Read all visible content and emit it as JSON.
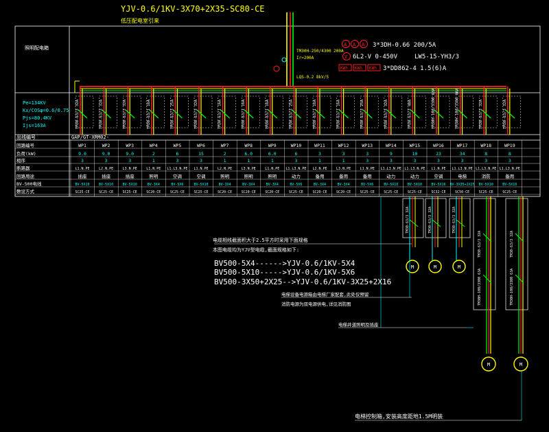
{
  "title": {
    "cable": "YJV-0.6/1KV-3X70+2X35-SC80-CE",
    "source": "低压配电室引来"
  },
  "panel": {
    "label": "照明配电箱",
    "params": [
      "Pe=134KV",
      "Kx/COSφ=0.6/0.75",
      "Pjs=80.4KV",
      "Ijs=163A"
    ]
  },
  "incoming": {
    "breaker": "TM30H-250/4300 200A",
    "setting": "Ir=200A",
    "surge": "LQS-0.2 8kV/5",
    "meters": [
      "A",
      "A",
      "A"
    ],
    "ct": "3*3DH-0.66 200/5A",
    "volt_meter": "V",
    "volt_label": "6L2-V 0-450V",
    "switch": "LW5-15-YH3/3",
    "kwh": [
      "KWh",
      "KWh",
      "KWh"
    ],
    "kwh_label": "3*DD862-4 1.5(6)A"
  },
  "table": {
    "header_label": "GAP/GT-XRM02-",
    "row_labels": [
      "回路编号",
      "负荷(kW)",
      "相序",
      "断路器",
      "回路用途",
      "BV-500电线",
      "敷设方式"
    ],
    "left_first": "出线编号",
    "circuits": [
      {
        "id": "WP1",
        "load": "9.0",
        "ph": "3",
        "breaker": "L1.N.PE",
        "use": "插座",
        "wire": "BV-5X10",
        "lay": "SC25-CE",
        "brk": "TM30-63/3 32A"
      },
      {
        "id": "WP2",
        "load": "9.0",
        "ph": "3",
        "breaker": "L2.N.PE",
        "use": "插座",
        "wire": "BV-5X10",
        "lay": "SC25-CE",
        "brk": "TM30-63/3 32A"
      },
      {
        "id": "WP3",
        "load": "9.0",
        "ph": "3",
        "breaker": "L3.N.PE",
        "use": "插座",
        "wire": "BV-5X10",
        "lay": "SC25-CE",
        "brk": "TM30-63/3 32A"
      },
      {
        "id": "WP4",
        "load": "2",
        "ph": "1",
        "breaker": "L1.N.PE",
        "use": "照明",
        "wire": "BV-3X4",
        "lay": "SC20-CE",
        "brk": "TM30-63/1 16A"
      },
      {
        "id": "WP5",
        "load": "6",
        "ph": "3",
        "breaker": "L1.L3.N.PE",
        "use": "空调",
        "wire": "BV-5X6",
        "lay": "SC25-CE",
        "brk": "TM30-63/3 25A"
      },
      {
        "id": "WP6",
        "load": "15",
        "ph": "3",
        "breaker": "L1.N.PE",
        "use": "空调",
        "wire": "BV-5X10",
        "lay": "SC25-CE",
        "brk": "TM30-63/3 32A"
      },
      {
        "id": "WP7",
        "load": "2",
        "ph": "1",
        "breaker": "L2.N.PE",
        "use": "照明",
        "wire": "BV-3X4",
        "lay": "SC20-CE",
        "brk": "TM30-63/1 16A"
      },
      {
        "id": "WP8",
        "load": "6.0",
        "ph": "1",
        "breaker": "L3.N.PE",
        "use": "照明",
        "wire": "BV-3X4",
        "lay": "SC20-CE",
        "brk": "TM30-63/1 16A"
      },
      {
        "id": "WP9",
        "load": "6.0",
        "ph": "1",
        "breaker": "L1.N.PE",
        "use": "照明",
        "wire": "BV-3X4",
        "lay": "SC20-CE",
        "brk": "TM30-63/1 16A"
      },
      {
        "id": "WP10",
        "load": "6",
        "ph": "3",
        "breaker": "L1.L3.N.PE",
        "use": "动力",
        "wire": "BV-5X6",
        "lay": "SC25-CE",
        "brk": "TM30-63/3 25A"
      },
      {
        "id": "WP11",
        "load": "3",
        "ph": "1",
        "breaker": "L2.N.PE",
        "use": "备用",
        "wire": "BV-3X4",
        "lay": "SC20-CE",
        "brk": "TM30-63/1 16A"
      },
      {
        "id": "WP12",
        "load": "3",
        "ph": "1",
        "breaker": "L3.N.PE",
        "use": "备用",
        "wire": "BV-3X4",
        "lay": "SC20-CE",
        "brk": "TM30-63/1 16A"
      },
      {
        "id": "WP13",
        "load": "3",
        "ph": "3",
        "breaker": "L1.N.PE",
        "use": "备用",
        "wire": "BV-5X6",
        "lay": "SC25-CE",
        "brk": "TM30-63/3 25A"
      },
      {
        "id": "WP14",
        "load": "9",
        "ph": "3",
        "breaker": "L1.L3.N.PE",
        "use": "动力",
        "wire": "BV-5X10",
        "lay": "SC25-CE",
        "brk": "TM30-63/3 32A"
      },
      {
        "id": "WP15",
        "load": "10",
        "ph": "3",
        "breaker": "L1.L3.N.PE",
        "use": "动力",
        "wire": "BV-5X10",
        "lay": "SC25-CE",
        "brk": "TM30-63/3 40A"
      },
      {
        "id": "WP16",
        "load": "23",
        "ph": "3",
        "breaker": "L1.N.PE",
        "use": "空调",
        "wire": "BV-5X16",
        "lay": "SC32-CE",
        "brk": "TM30H-100/3300 63A"
      },
      {
        "id": "WP17",
        "load": "34",
        "ph": "3",
        "breaker": "L1.L3.N.PE",
        "use": "电梯",
        "wire": "BV-3X35+2X25",
        "lay": "SC50-CE",
        "brk": "TM30H-100/3300 80A"
      },
      {
        "id": "WP18",
        "load": "8",
        "ph": "3",
        "breaker": "L1.L3.N.PE",
        "use": "消防",
        "wire": "BV-5X10",
        "lay": "SC25-CE",
        "brk": "TM30-63/3 32A"
      },
      {
        "id": "WP19",
        "load": "8",
        "ph": "3",
        "breaker": "L1.L3.N.PE",
        "use": "备用",
        "wire": "BV-5X10",
        "lay": "SC25-CE",
        "brk": "TM30-63/3 32A"
      }
    ]
  },
  "notes": {
    "n1": "电缆相线截面积大于2.5平方时采用下面规格",
    "n2": "本图电缆均为YJV型电缆,截面规格如下:",
    "conversions": [
      "BV500-5X4------>YJV-0.6/1KV-5X4",
      "BV500-5X10----->YJV-0.6/1KV-5X6",
      "BV500-3X50+2X25-->YJV-0.6/1KV-3X25+2X16"
    ],
    "n3": "电梯设备电源箱由电梯厂家配套,此处仅预留",
    "n4": "消防电源为双电源供电,详见消防图",
    "n5": "电梯井道照明及插座",
    "n6": "电梯控制箱,安装高度距地1.5M明装"
  },
  "sub_panels": {
    "small": [
      {
        "brk": "TM30-63/3 32A",
        "motor": "M"
      },
      {
        "brk": "TM30-63/3 32A",
        "motor": "M"
      },
      {
        "brk": "TM30-63/3 32A",
        "motor": "M"
      }
    ],
    "large": [
      {
        "brk": "TM30-63/3 32A",
        "brk2": "TM30H-100/3300 63A",
        "motor": "M"
      },
      {
        "brk": "TM30-63/3 32A",
        "brk2": "TM30H-100/3300 63A",
        "motor": "M"
      }
    ]
  },
  "colors": {
    "bg": "#000000",
    "yellow": "#ffff00",
    "red": "#ff2020",
    "green": "#00ff00",
    "cyan": "#00ffff",
    "white": "#ffffff",
    "blue": "#3060ff",
    "gray": "#a0a0a0"
  }
}
